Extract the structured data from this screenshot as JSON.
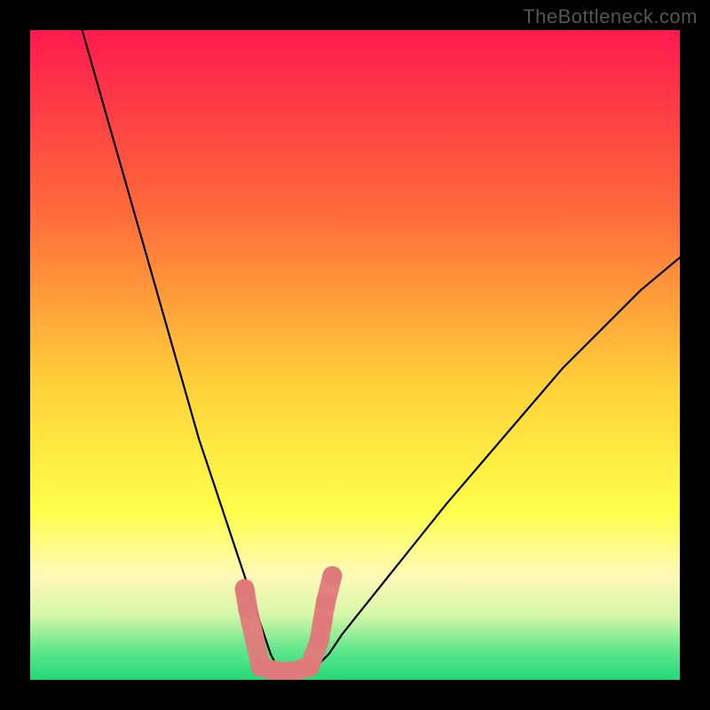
{
  "watermark": "TheBottleneck.com",
  "chart_data": {
    "type": "line",
    "title": "",
    "xlabel": "",
    "ylabel": "",
    "xlim": [
      0,
      100
    ],
    "ylim": [
      0,
      100
    ],
    "axes_visible": false,
    "grid": false,
    "background_gradient": {
      "stops": [
        {
          "offset": 0.0,
          "color": "#ff1a4f"
        },
        {
          "offset": 0.28,
          "color": "#ff6a3a"
        },
        {
          "offset": 0.55,
          "color": "#ffd23a"
        },
        {
          "offset": 0.74,
          "color": "#ffff4a"
        },
        {
          "offset": 0.84,
          "color": "#fff9b8"
        },
        {
          "offset": 0.9,
          "color": "#d6f7a8"
        },
        {
          "offset": 0.955,
          "color": "#5fe68c"
        },
        {
          "offset": 1.0,
          "color": "#22d877"
        }
      ]
    },
    "series": [
      {
        "name": "bottleneck-curve",
        "type": "line",
        "stroke": "#000000",
        "stroke_width": 2.2,
        "x": [
          8,
          10,
          12,
          14,
          16,
          18,
          20,
          22,
          24,
          26,
          28,
          30,
          32,
          34,
          35,
          36,
          37,
          38,
          40,
          42,
          44,
          46,
          48,
          52,
          56,
          60,
          64,
          70,
          76,
          82,
          88,
          94,
          100
        ],
        "y": [
          100,
          93,
          86,
          79,
          72,
          65,
          58,
          51,
          44,
          37,
          31,
          25,
          19,
          13,
          10,
          7,
          4,
          2,
          1,
          1,
          2,
          4,
          7,
          12,
          17,
          22,
          27,
          34,
          41,
          48,
          54,
          60,
          65
        ]
      },
      {
        "name": "highlight-bead-segment",
        "type": "scatter",
        "marker_shape": "rounded",
        "marker_color": "#e07a7a",
        "marker_size": 22,
        "x": [
          33.0,
          33.5,
          35.5,
          38.0,
          40.5,
          43.0,
          44.5,
          45.0,
          45.5,
          46.5
        ],
        "y": [
          14.0,
          11.0,
          2.0,
          1.3,
          1.3,
          2.0,
          6.0,
          9.0,
          12.0,
          16.0
        ]
      }
    ]
  }
}
